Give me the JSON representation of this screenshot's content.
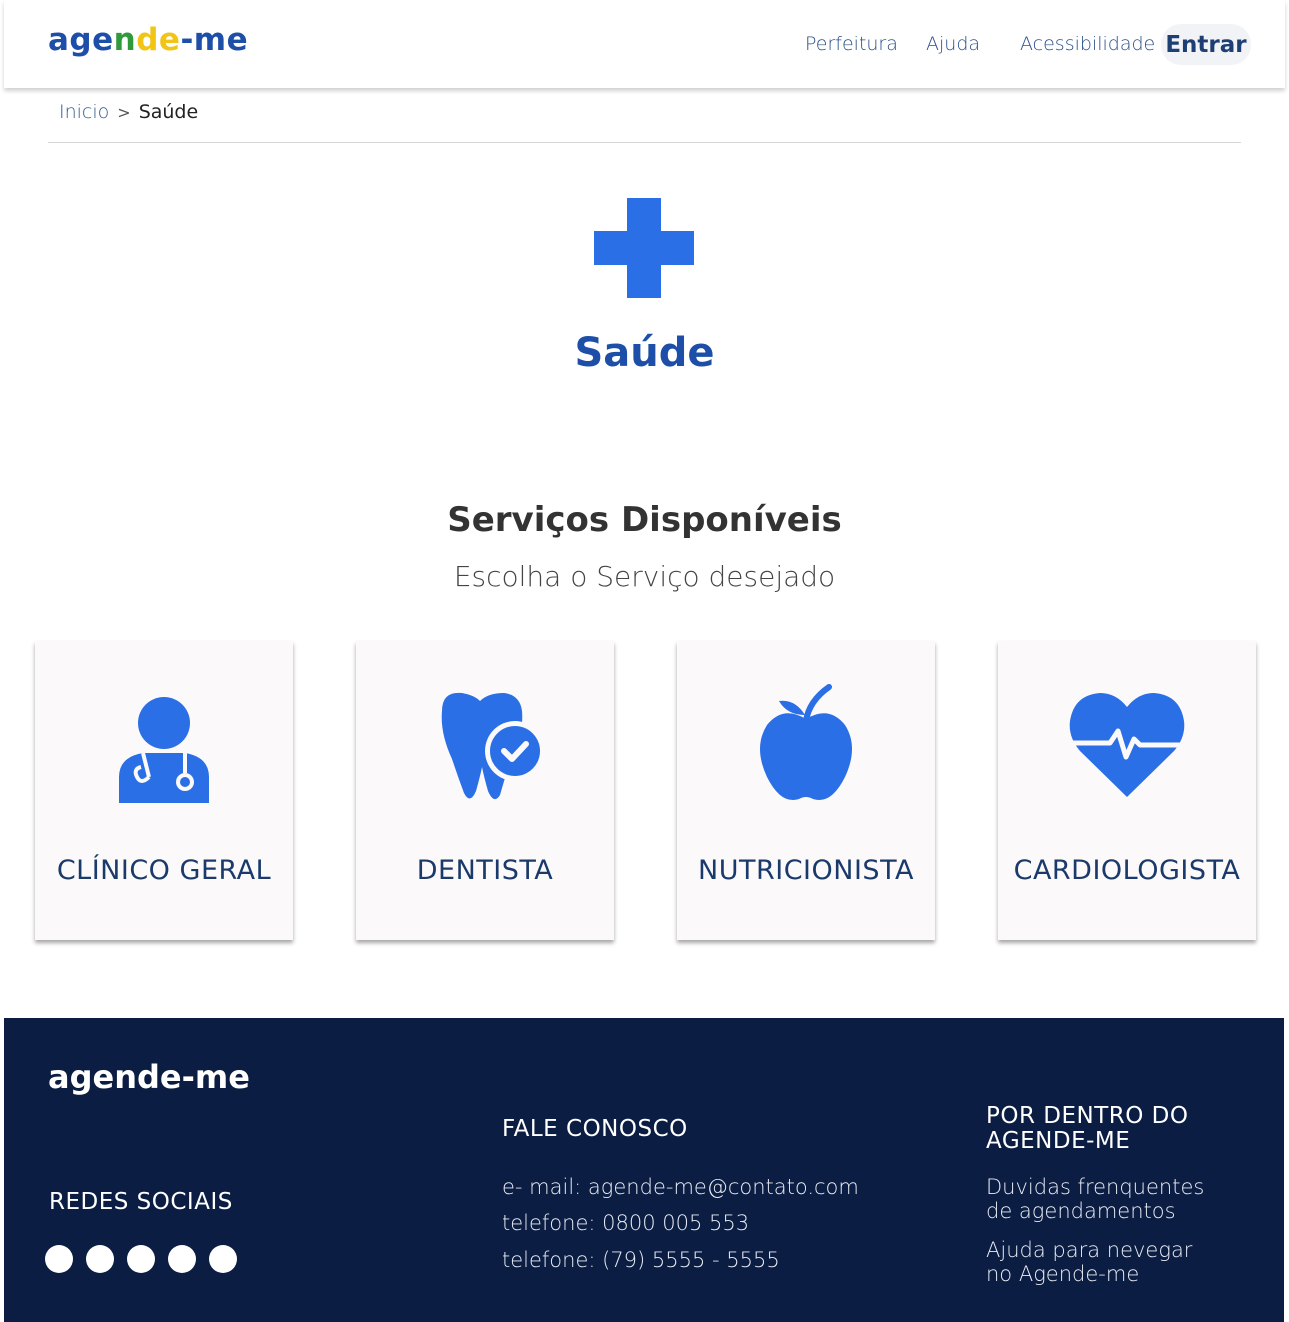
{
  "header": {
    "logo": {
      "part1": "age",
      "part2": "n",
      "part3": "de",
      "part4": "-me"
    },
    "nav": {
      "perfeitura": "Perfeitura",
      "ajuda": "Ajuda",
      "acessibilidade": "Acessibilidade",
      "entrar": "Entrar"
    }
  },
  "breadcrumb": {
    "home": "Inicio",
    "separator": ">",
    "current": "Saúde"
  },
  "hero": {
    "icon": "medical-cross-icon",
    "title": "Saúde"
  },
  "services": {
    "title": "Serviços Disponíveis",
    "subtitle": "Escolha o Serviço desejado",
    "items": [
      {
        "label": "CLÍNICO GERAL",
        "icon": "doctor-icon"
      },
      {
        "label": "DENTISTA",
        "icon": "tooth-check-icon"
      },
      {
        "label": "NUTRICIONISTA",
        "icon": "apple-icon"
      },
      {
        "label": "CARDIOLOGISTA",
        "icon": "heart-pulse-icon"
      }
    ]
  },
  "footer": {
    "logo": "agende-me",
    "social_title": "REDES SOCIAIS",
    "contact_title": "FALE CONOSCO",
    "email": "e- mail: agende-me@contato.com",
    "phone1": "telefone: 0800 005 553",
    "phone2": "telefone: (79) 5555 - 5555",
    "about_title": "POR DENTRO DO AGENDE-ME",
    "link1": "Duvidas frenquentes de agendamentos",
    "link2": "Ajuda para nevegar no Agende-me"
  },
  "colors": {
    "primary": "#1e4fa8",
    "icon_blue": "#2a6fe6",
    "footer_bg": "#0b1d42",
    "green": "#2e9a3a",
    "yellow": "#f2c416"
  }
}
